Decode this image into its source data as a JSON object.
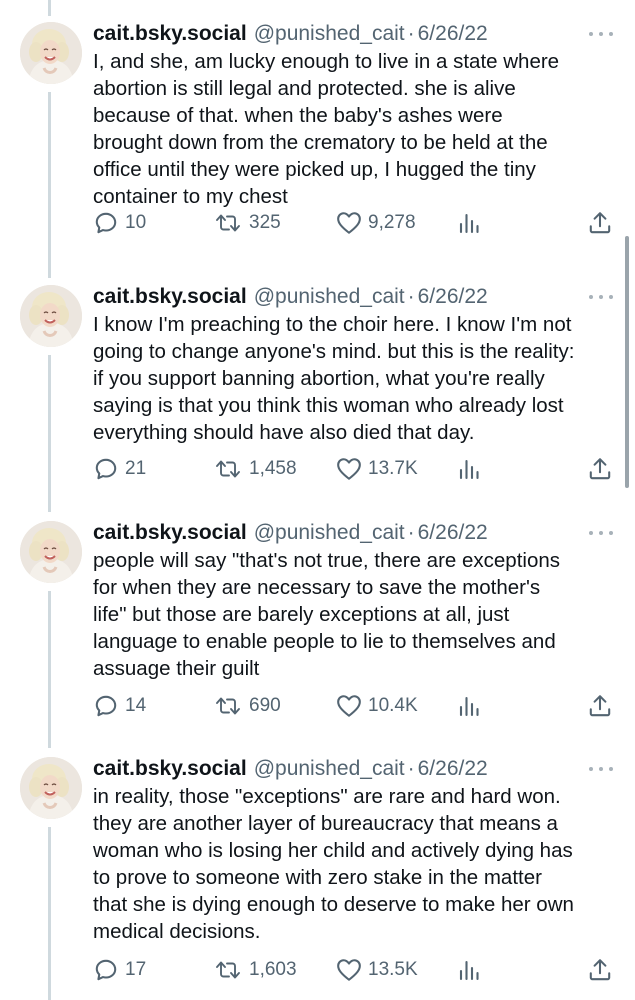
{
  "colors": {
    "text": "#0f1419",
    "secondary": "#536471",
    "thread_line": "#cfd9de"
  },
  "icons": {
    "reply": "reply-icon",
    "retweet": "retweet-icon",
    "like": "heart-icon",
    "views": "views-icon",
    "share": "share-icon",
    "more": "more-icon"
  },
  "tweets": [
    {
      "name": "cait.bsky.social",
      "handle": "@punished_cait",
      "dot": "·",
      "date": "6/26/22",
      "lines": [
        "I, and she, am lucky enough to live in a state where",
        "abortion is still legal and protected. she is alive",
        "because of that. when the baby's ashes were",
        "brought down from the crematory to be held at the",
        "office until they were picked up, I hugged the tiny",
        "container to my chest"
      ],
      "replies": "10",
      "retweets": "325",
      "likes": "9,278"
    },
    {
      "name": "cait.bsky.social",
      "handle": "@punished_cait",
      "dot": "·",
      "date": "6/26/22",
      "lines": [
        "I know I'm preaching to the choir here. I know I'm not",
        "going to change anyone's mind. but this is the reality:",
        "if you support banning abortion, what you're really",
        "saying is that you think this woman who already lost",
        "everything should have also died that day."
      ],
      "replies": "21",
      "retweets": "1,458",
      "likes": "13.7K"
    },
    {
      "name": "cait.bsky.social",
      "handle": "@punished_cait",
      "dot": "·",
      "date": "6/26/22",
      "lines": [
        "people will say \"that's not true, there are exceptions",
        "for when they are necessary to save the mother's",
        "life\" but those are barely exceptions at all, just",
        "language to enable people to lie to themselves and",
        "assuage their guilt"
      ],
      "replies": "14",
      "retweets": "690",
      "likes": "10.4K"
    },
    {
      "name": "cait.bsky.social",
      "handle": "@punished_cait",
      "dot": "·",
      "date": "6/26/22",
      "lines": [
        "in reality, those \"exceptions\" are rare and hard won.",
        "they are another layer of bureaucracy that means a",
        "woman who is losing her child and actively dying has",
        "to prove to someone with zero stake in the matter",
        "that she is dying enough to deserve to make her own",
        "medical decisions."
      ],
      "replies": "17",
      "retweets": "1,603",
      "likes": "13.5K"
    }
  ]
}
